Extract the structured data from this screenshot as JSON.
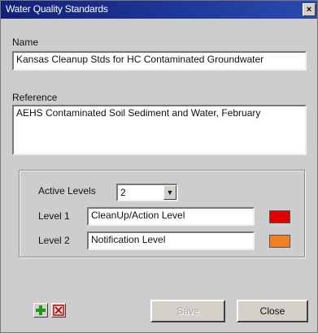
{
  "window": {
    "title": "Water Quality Standards"
  },
  "name": {
    "label": "Name",
    "value": "Kansas Cleanup Stds for HC Contaminated Groundwater"
  },
  "reference": {
    "label": "Reference",
    "value": "AEHS Contaminated Soil Sediment and Water, February"
  },
  "levels": {
    "active_label": "Active Levels",
    "active_value": "2",
    "items": [
      {
        "label": "Level 1",
        "value": "CleanUp/Action Level",
        "color": "#e00000"
      },
      {
        "label": "Level 2",
        "value": "Notification Level",
        "color": "#f08020"
      }
    ]
  },
  "buttons": {
    "save": "Save",
    "close": "Close"
  },
  "icons": {
    "add": "plus-icon",
    "delete": "delete-icon"
  },
  "colors": {
    "titlebar": "#11207a",
    "add_green": "#1a9a1a",
    "delete_red": "#cc0000"
  }
}
